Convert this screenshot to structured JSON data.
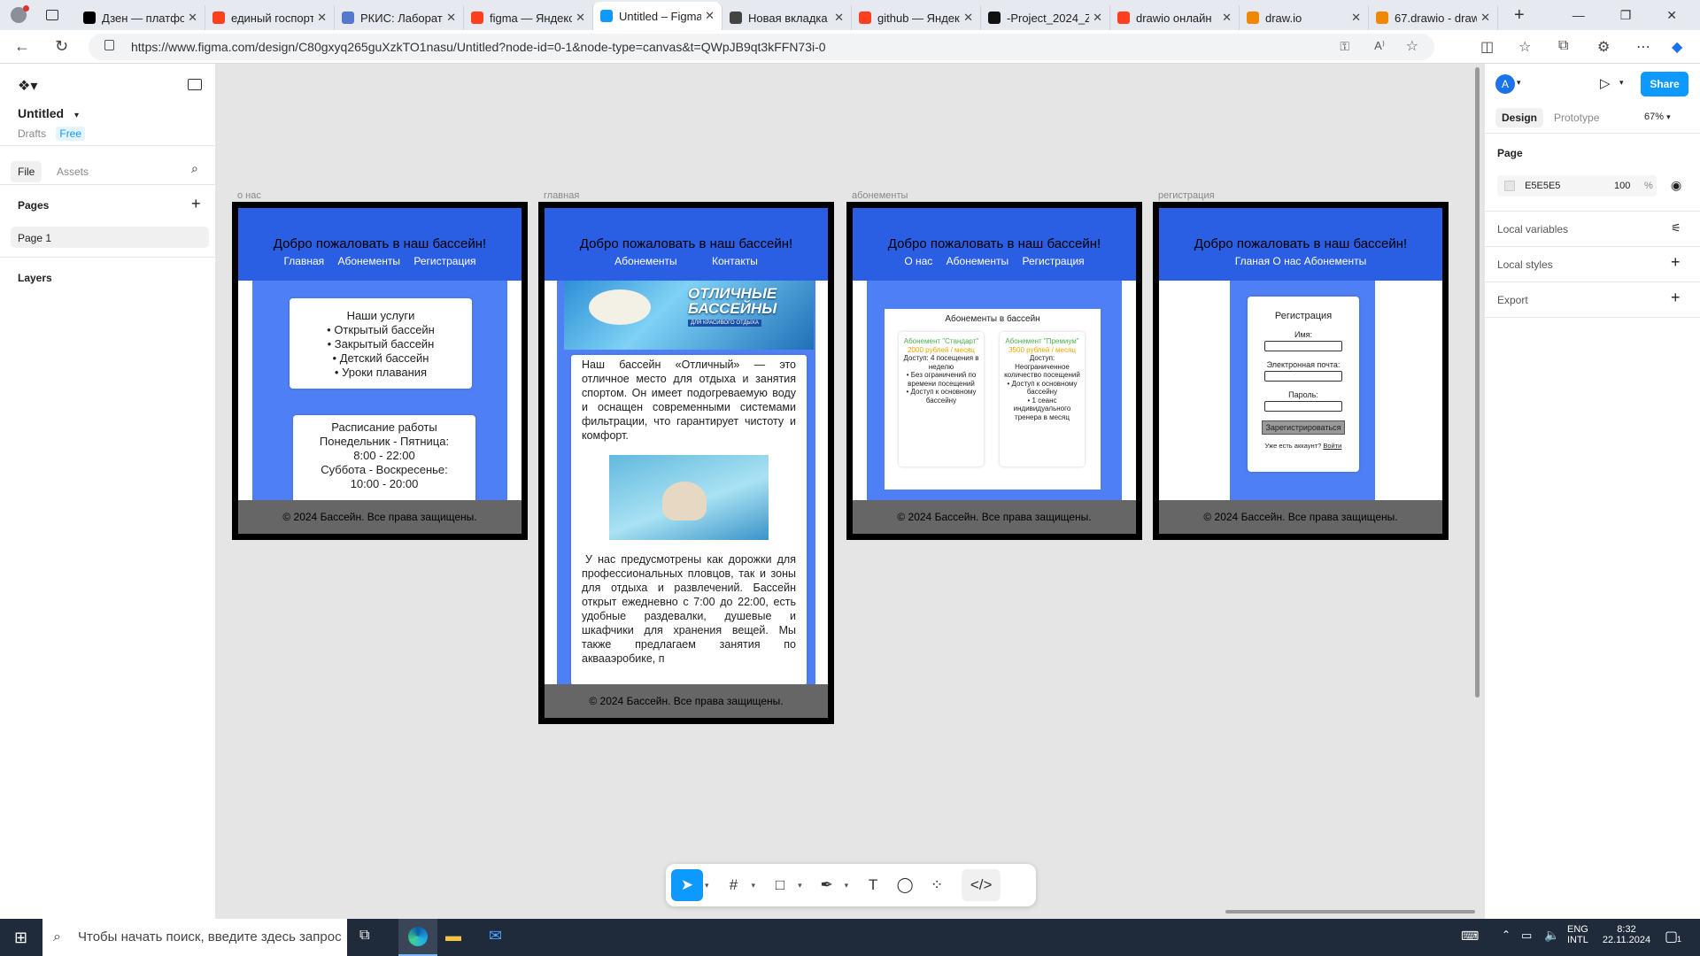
{
  "browser": {
    "tabs": [
      {
        "label": "Дзен — платформа",
        "fav": "dzen",
        "color": "#000000"
      },
      {
        "label": "единый госпорт",
        "fav": "yandex",
        "color": "#fc3f1d"
      },
      {
        "label": "РКИС: Лаборат",
        "fav": "rkis",
        "color": "#5577cc"
      },
      {
        "label": "figma — Яндекс",
        "fav": "yandex",
        "color": "#fc3f1d"
      },
      {
        "label": "Untitled – Figma",
        "fav": "figma",
        "color": "#0d99ff",
        "active": true
      },
      {
        "label": "Новая вкладка",
        "fav": "newtab",
        "color": "#444444"
      },
      {
        "label": "github — Яндекс",
        "fav": "yandex",
        "color": "#fc3f1d"
      },
      {
        "label": "-Project_2024_Z",
        "fav": "github",
        "color": "#111111"
      },
      {
        "label": "drawio онлайн",
        "fav": "yandex",
        "color": "#fc3f1d"
      },
      {
        "label": "draw.io",
        "fav": "drawio",
        "color": "#f08705"
      },
      {
        "label": "67.drawio - draw",
        "fav": "drawio",
        "color": "#f08705"
      }
    ],
    "url": "https://www.figma.com/design/C80gxyq265guXzkTO1nasu/Untitled?node-id=0-1&node-type=canvas&t=QWpJB9qt3kFFN73i-0"
  },
  "left": {
    "file_title": "Untitled",
    "drafts": "Drafts",
    "plan": "Free",
    "tab_file": "File",
    "tab_assets": "Assets",
    "pages_header": "Pages",
    "page1": "Page 1",
    "layers_header": "Layers"
  },
  "right": {
    "avatar": "A",
    "share": "Share",
    "tab_design": "Design",
    "tab_prototype": "Prototype",
    "zoom": "67%",
    "page_section": "Page",
    "bg_color": "E5E5E5",
    "bg_opacity": "100",
    "bg_pct": "%",
    "local_variables": "Local variables",
    "local_styles": "Local styles",
    "export": "Export"
  },
  "frames": {
    "about": {
      "label": "о нас",
      "title": "Добро пожаловать в наш бассейн!",
      "links": [
        "Главная",
        "Абонементы",
        "Регистрация"
      ],
      "services_title": "Наши услуги",
      "services": [
        "Открытый бассейн",
        "Закрытый бассейн",
        "Детский бассейн",
        "Уроки плавания"
      ],
      "schedule_lines": [
        "Расписание работы",
        "Понедельник - Пятница:",
        "8:00 - 22:00",
        "Суббота - Воскресенье:",
        "10:00 - 20:00"
      ],
      "footer": "© 2024 Бассейн. Все права защищены."
    },
    "main": {
      "label": "главная",
      "title": "Добро пожаловать в наш бассейн!",
      "links": [
        "Абонементы",
        "Контакты"
      ],
      "banner_line1": "ОТЛИЧНЫЕ",
      "banner_line2": "БАССЕЙНЫ",
      "banner_sub": "ДЛЯ КРАСИВОГО ОТДЫХА",
      "para1": "Наш бассейн «Отличный» — это отличное место для отдыха и занятия спортом. Он имеет подогреваемую воду и оснащен современными системами фильтрации, что гарантирует чистоту и комфорт.",
      "para2": "У нас предусмотрены как дорожки для профессиональных пловцов, так и зоны для отдыха и развлечений. Бассейн открыт ежедневно с 7:00 до 22:00, есть удобные раздевалки, душевые и шкафчики для хранения вещей. Мы также предлагаем занятия по аквааэробике, п",
      "footer": "© 2024 Бассейн. Все права защищены."
    },
    "subs": {
      "label": "абонементы",
      "title": "Добро пожаловать в наш бассейн!",
      "links": [
        "О нас",
        "Абонементы",
        "Регистрация"
      ],
      "section_title": "Абонементы в бассейн",
      "standard": {
        "name": "Абонемент \"Стандарт\"",
        "price": "2000 рублей / месяц",
        "items": [
          "Доступ: 4 посещения в неделю",
          "Без ограничений по времени посещений",
          "Доступ к основному бассейну"
        ]
      },
      "premium": {
        "name": "Абонемент \"Премиум\"",
        "price": "3500 рублей / месяц",
        "items": [
          "Доступ: Неограниченное количество посещений",
          "Доступ к основному бассейну",
          "1 сеанс индивидуального тренера в месяц"
        ]
      },
      "footer": "© 2024 Бассейн. Все права защищены."
    },
    "reg": {
      "label": "регистрация",
      "title": "Добро пожаловать в наш бассейн!",
      "links_text": "Гланая О нас Абонементы",
      "form_title": "Регистрация",
      "name_label": "Имя:",
      "email_label": "Электронная почта:",
      "password_label": "Пароль:",
      "submit": "Зарегистрироваться",
      "have_account": "Уже есть аккаунт?",
      "login": "Войти",
      "footer": "© 2024 Бассейн. Все права защищены."
    }
  },
  "taskbar": {
    "search_placeholder": "Чтобы начать поиск, введите здесь запрос",
    "lang1": "ENG",
    "lang2": "INTL",
    "time": "8:32",
    "date": "22.11.2024",
    "notif_count": "1"
  },
  "colors": {
    "figma_blue": "#0d99ff",
    "header_blue": "#2b5fe3",
    "frame_blue": "#4f7ff5",
    "footer_gray": "#666666",
    "canvas_bg": "#e5e5e5",
    "green_text": "#4caf50",
    "orange_text": "#f0a500"
  }
}
